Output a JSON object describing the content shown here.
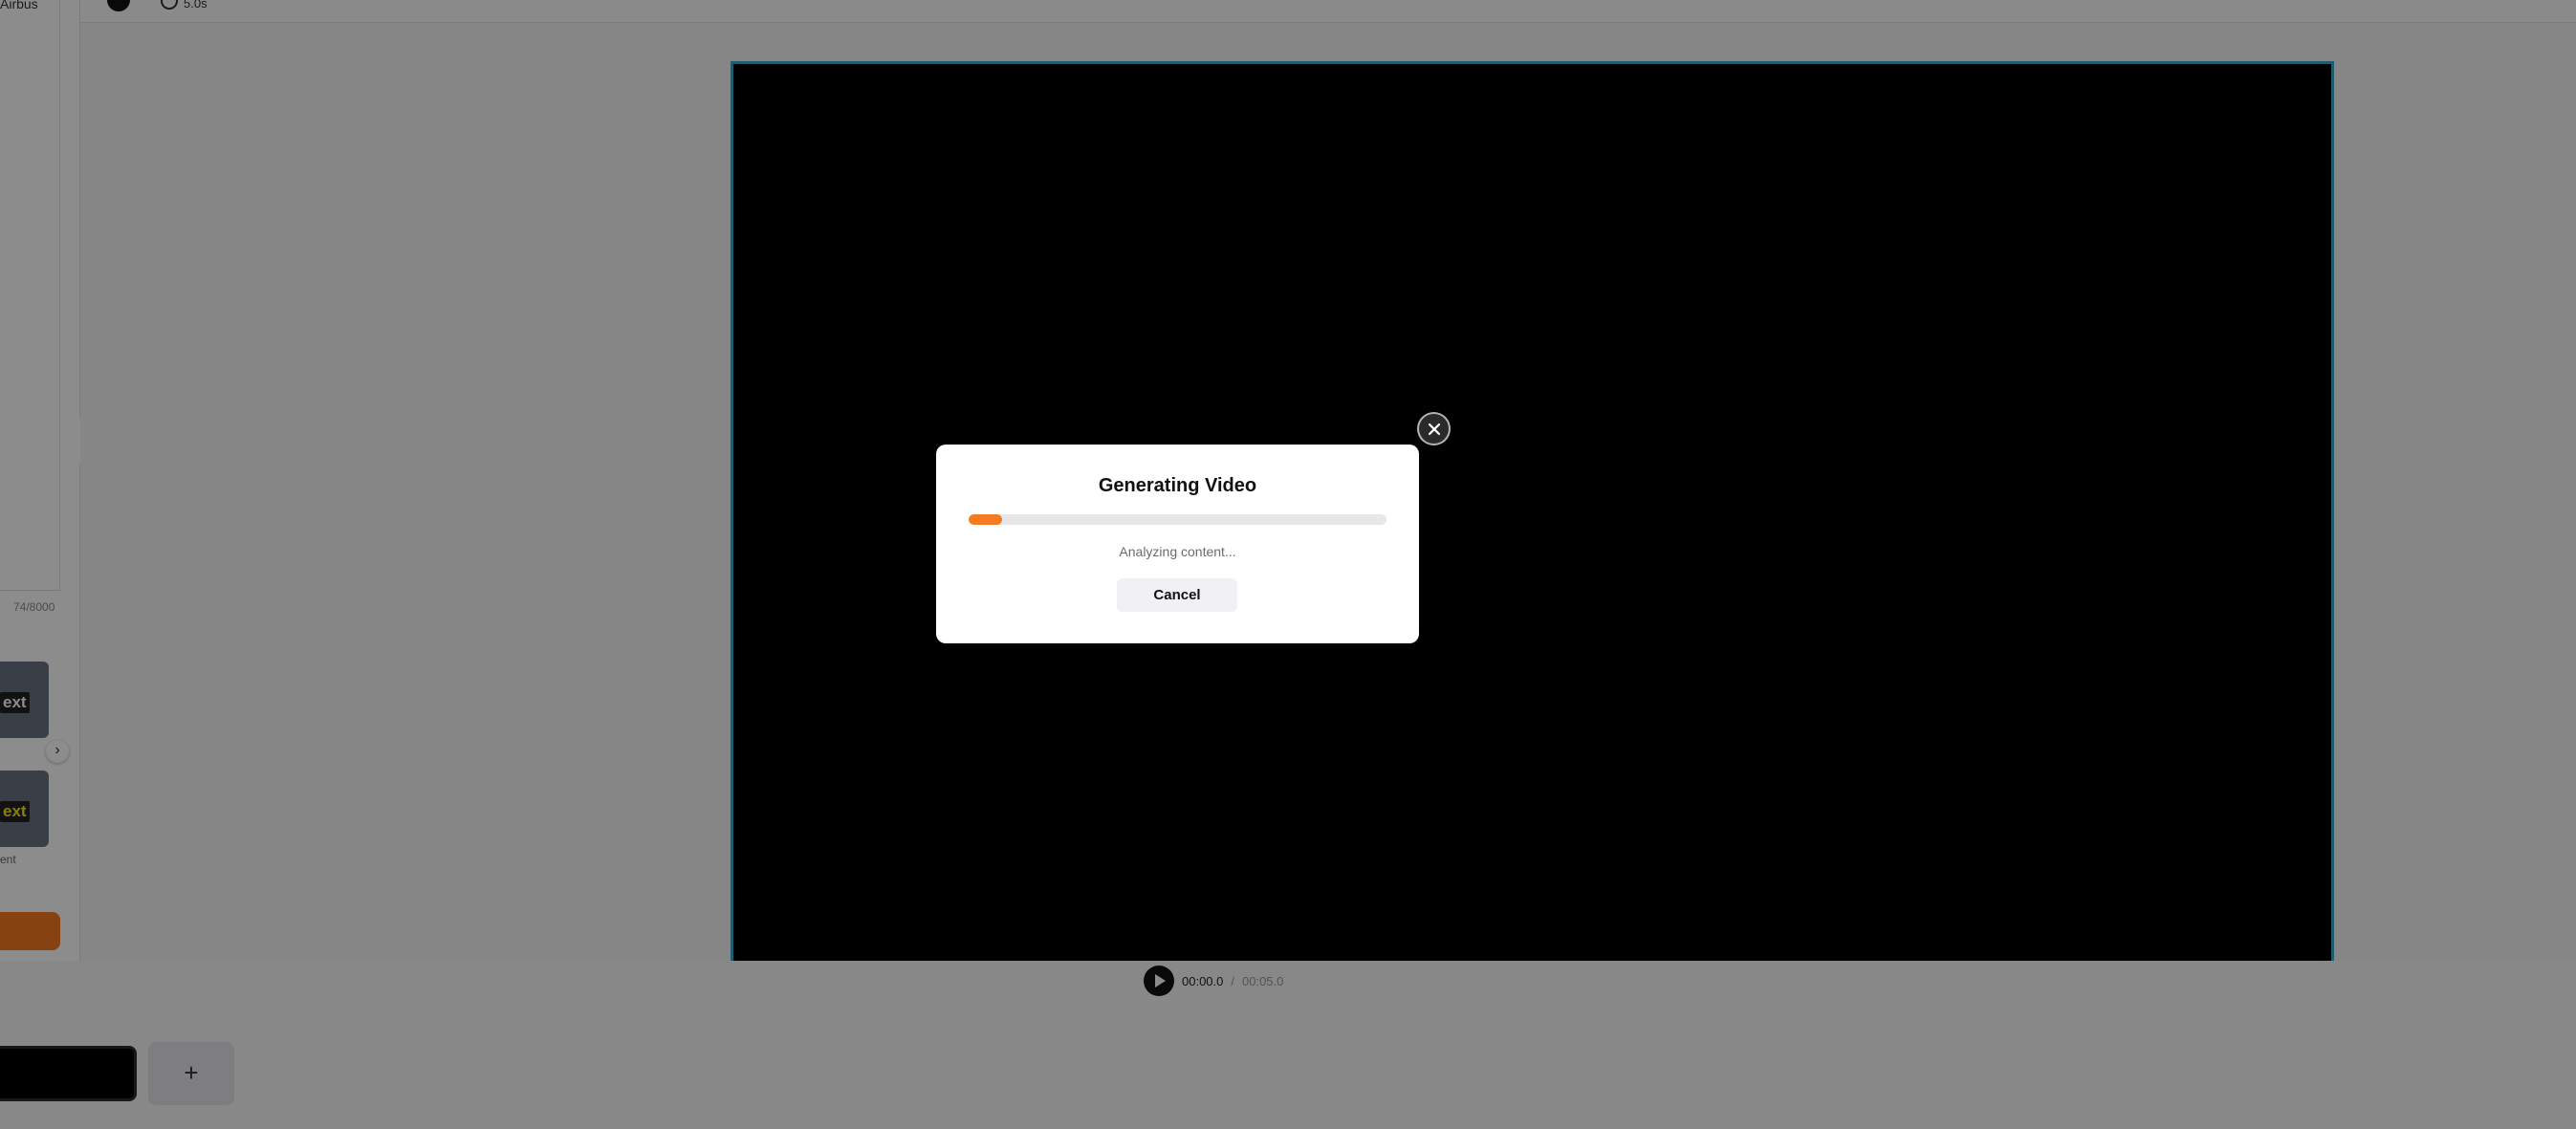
{
  "sidebar": {
    "voice_label": "Airbus",
    "char_count": "74/8000",
    "tiles": [
      {
        "label": "ext"
      },
      {
        "label": "ext"
      }
    ],
    "tile_caption": "ent"
  },
  "toolbar": {
    "duration": "5.0s"
  },
  "player": {
    "current_time": "00:00.0",
    "separator": "/",
    "total_time": "00:05.0"
  },
  "timeline": {
    "add_label": "+"
  },
  "modal": {
    "title": "Generating Video",
    "progress_percent": 8,
    "status": "Analyzing content...",
    "cancel_label": "Cancel"
  },
  "colors": {
    "accent": "#f47b20",
    "frame_border": "#3aa8c9"
  },
  "icons": {
    "close": "close-icon",
    "play": "play-icon",
    "duration": "clock-icon"
  }
}
